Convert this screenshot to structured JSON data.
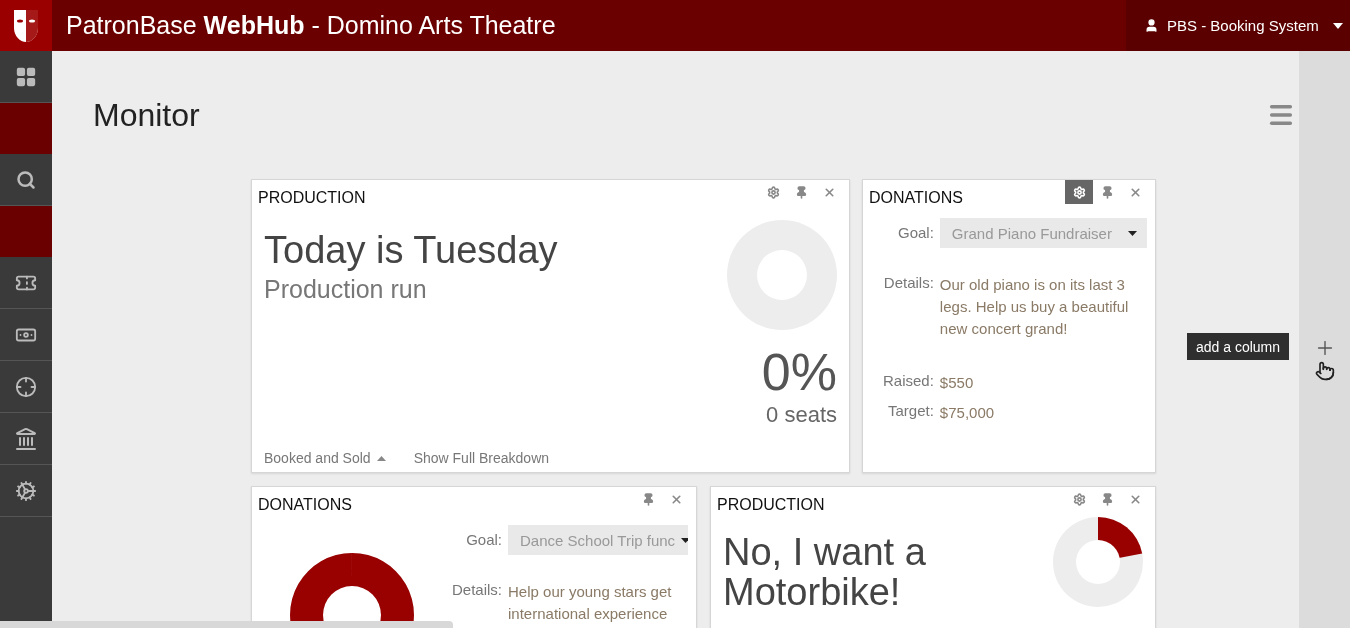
{
  "header": {
    "brand": "PatronBase **WebHub** - Domino Arts Theatre",
    "user_menu": "PBS - Booking System"
  },
  "page": {
    "title": "Monitor"
  },
  "add_column": {
    "tooltip": "add a column"
  },
  "rows": [
    [
      {
        "kind": "production",
        "title": "PRODUCTION",
        "tools": [
          {
            "kind": "settings",
            "selected": false
          },
          {
            "kind": "pin",
            "selected": false
          },
          {
            "kind": "close",
            "selected": false
          }
        ],
        "heading": "Today is Tuesday",
        "subheading": "Production run",
        "percent": "0%",
        "seats": "0 seats",
        "links": [
          "Booked and Sold",
          "Show Full Breakdown"
        ]
      },
      {
        "kind": "donations",
        "title": "DONATIONS",
        "tools": [
          {
            "kind": "settings",
            "selected": true
          },
          {
            "kind": "pin",
            "selected": false
          },
          {
            "kind": "close",
            "selected": false
          }
        ],
        "goal_label": "Goal:",
        "goal": "Grand Piano Fundraiser",
        "details_label": "Details:",
        "details": "Our old piano is on its last 3 legs. Help us buy a beautiful new concert grand!",
        "raised_label": "Raised:",
        "raised": "$550",
        "target_label": "Target:",
        "target": "$75,000"
      }
    ],
    [
      {
        "kind": "donations",
        "title": "DONATIONS",
        "tools": [
          {
            "kind": "pin",
            "selected": false
          },
          {
            "kind": "close",
            "selected": false
          }
        ],
        "chart": true,
        "goal_label": "Goal:",
        "goal": "Dance School Trip func",
        "details_label": "Details:",
        "details": "Help our young stars get international experience"
      },
      {
        "kind": "production",
        "title": "PRODUCTION",
        "tools": [
          {
            "kind": "settings",
            "selected": false
          },
          {
            "kind": "pin",
            "selected": false
          },
          {
            "kind": "close",
            "selected": false
          }
        ],
        "heading": "No, I want a Motorbike!"
      }
    ]
  ]
}
